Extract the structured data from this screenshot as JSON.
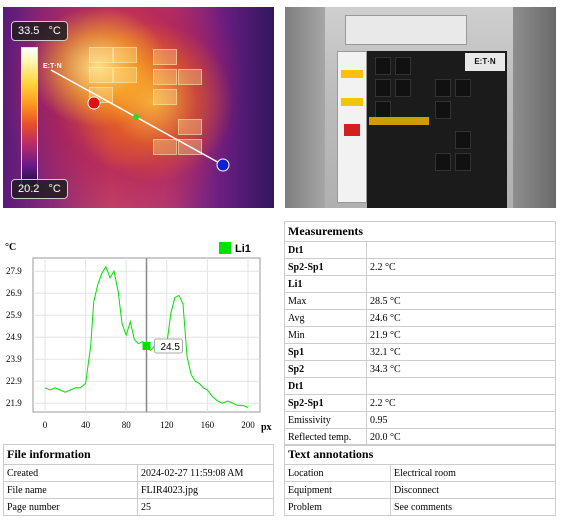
{
  "thermal": {
    "max_temp": "33.5",
    "min_temp": "20.2",
    "unit": "°C"
  },
  "photo_label_text": {
    "brand": "E:T·N"
  },
  "chart_data": {
    "type": "line",
    "ylabel": "°C",
    "xlabel_unit": "px",
    "x_ticks": [
      0,
      40,
      80,
      120,
      160,
      200
    ],
    "y_ticks": [
      21.9,
      22.9,
      23.9,
      24.9,
      25.9,
      26.9,
      27.9
    ],
    "y_tick_labels": [
      "21.9",
      "22.9",
      "23.9",
      "24.9",
      "25.9",
      "26.9",
      "27.9"
    ],
    "xlim": [
      0,
      200
    ],
    "ylim": [
      21.5,
      28.5
    ],
    "cursor_x": 100,
    "cursor_label": "24.5",
    "series": [
      {
        "name": "Li1",
        "color": "#00e000",
        "x": [
          0,
          5,
          10,
          15,
          20,
          25,
          30,
          35,
          40,
          45,
          48,
          52,
          56,
          60,
          64,
          68,
          72,
          76,
          80,
          84,
          88,
          92,
          96,
          100,
          104,
          108,
          112,
          116,
          120,
          124,
          128,
          132,
          136,
          140,
          144,
          148,
          152,
          156,
          160,
          165,
          170,
          175,
          180,
          185,
          190,
          195,
          200
        ],
        "y": [
          22.6,
          22.5,
          22.6,
          22.5,
          22.4,
          22.5,
          22.6,
          22.6,
          22.8,
          24.5,
          26.5,
          27.3,
          27.8,
          28.1,
          27.6,
          27.9,
          27.0,
          25.5,
          25.0,
          25.6,
          24.8,
          24.6,
          24.7,
          24.5,
          24.3,
          24.5,
          24.4,
          24.3,
          24.6,
          26.0,
          26.7,
          26.8,
          26.4,
          24.0,
          23.2,
          22.9,
          22.8,
          22.6,
          22.5,
          22.2,
          22.0,
          21.9,
          22.0,
          21.9,
          21.8,
          21.8,
          21.7
        ]
      }
    ]
  },
  "measurements": {
    "title": "Measurements",
    "rows": [
      {
        "label": "Dt1",
        "value": "",
        "bold": true
      },
      {
        "label": "Sp2-Sp1",
        "value": "2.2 °C",
        "bold": true
      },
      {
        "label": "Li1",
        "value": "",
        "bold": true
      },
      {
        "label": "Max",
        "value": "28.5 °C",
        "bold": false
      },
      {
        "label": "Avg",
        "value": "24.6 °C",
        "bold": false
      },
      {
        "label": "Min",
        "value": "21.9 °C",
        "bold": false
      },
      {
        "label": "Sp1",
        "value": "32.1 °C",
        "bold": true
      },
      {
        "label": "Sp2",
        "value": "34.3 °C",
        "bold": true
      },
      {
        "label": "Dt1",
        "value": "",
        "bold": true
      },
      {
        "label": "Sp2-Sp1",
        "value": "2.2 °C",
        "bold": true
      },
      {
        "label": "Emissivity",
        "value": "0.95",
        "bold": false
      },
      {
        "label": "Reflected temp.",
        "value": "20.0 °C",
        "bold": false
      }
    ]
  },
  "file_info": {
    "title": "File information",
    "rows": [
      {
        "label": "Created",
        "value": "2024-02-27 11:59:08 AM"
      },
      {
        "label": "File name",
        "value": "FLIR4023.jpg"
      },
      {
        "label": "Page number",
        "value": "25"
      }
    ]
  },
  "text_annotations": {
    "title": "Text annotations",
    "rows": [
      {
        "label": "Location",
        "value": "Electrical room"
      },
      {
        "label": "Equipment",
        "value": "Disconnect"
      },
      {
        "label": "Problem",
        "value": "See comments"
      }
    ]
  }
}
